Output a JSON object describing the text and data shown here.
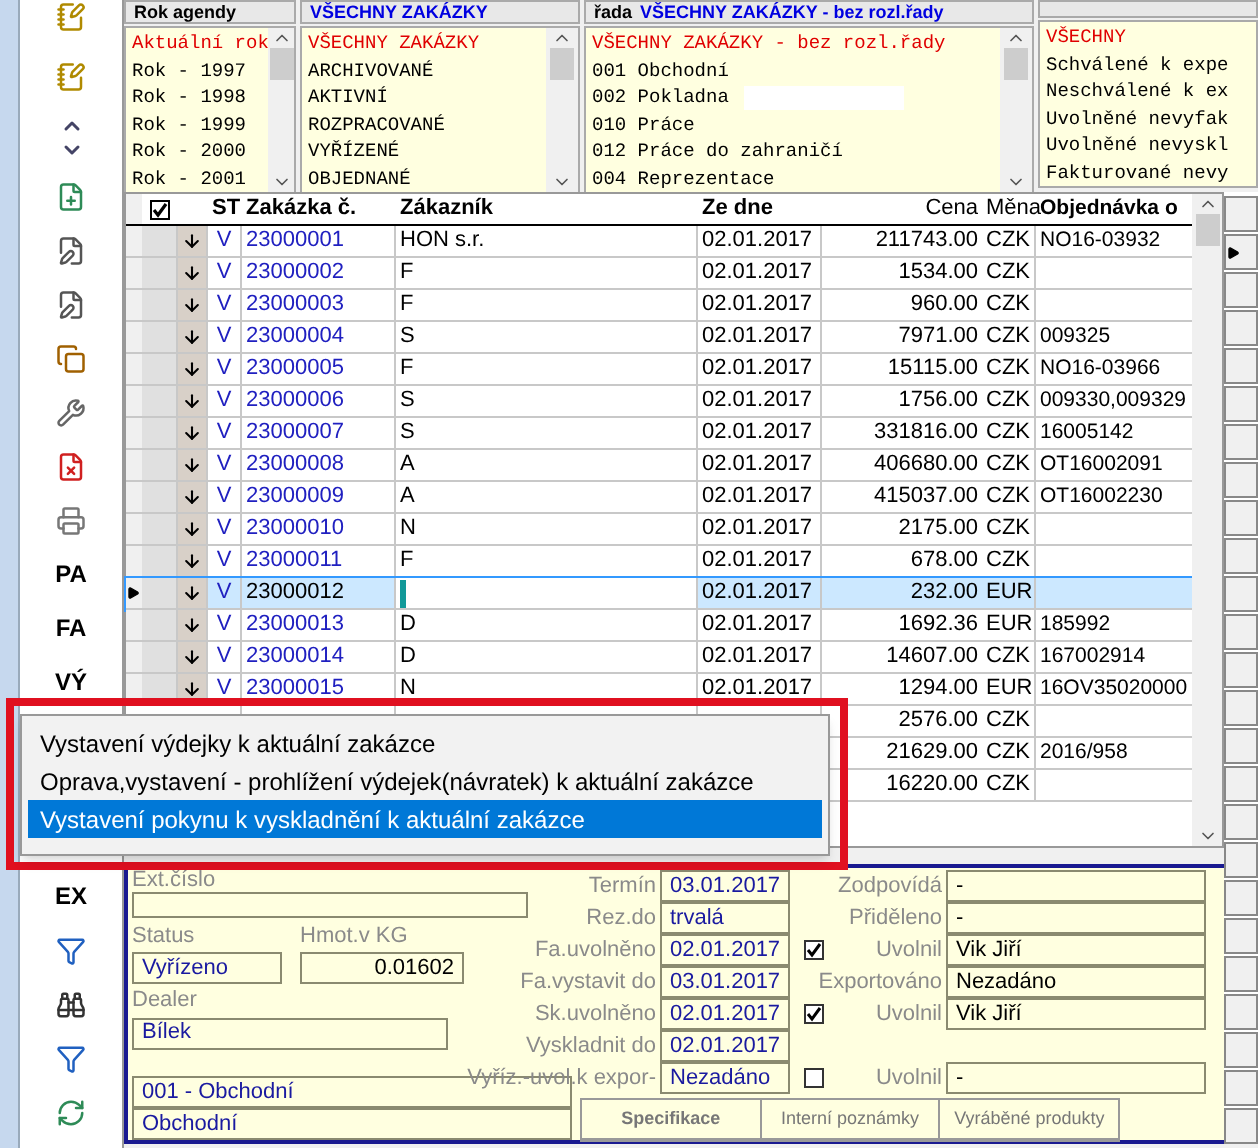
{
  "toolbar": [
    {
      "kind": "notes"
    },
    {
      "kind": "notes"
    },
    {
      "kind": "updown"
    },
    {
      "kind": "add"
    },
    {
      "kind": "edit"
    },
    {
      "kind": "edit"
    },
    {
      "kind": "copy"
    },
    {
      "kind": "tool"
    },
    {
      "kind": "delete"
    },
    {
      "kind": "print"
    },
    {
      "kind": "text",
      "label": "PA"
    },
    {
      "kind": "text",
      "label": "FA"
    },
    {
      "kind": "text",
      "label": "VÝ"
    },
    {
      "kind": "gap"
    },
    {
      "kind": "text",
      "label": "EX"
    },
    {
      "kind": "filter"
    },
    {
      "kind": "find"
    },
    {
      "kind": "filter"
    },
    {
      "kind": "refresh"
    }
  ],
  "lists": [
    {
      "header": "Rok agendy",
      "items": [
        {
          "text": "Aktuální rok",
          "selected": true
        },
        {
          "text": "Rok - 1997",
          "selected": false
        },
        {
          "text": "Rok - 1998",
          "selected": false
        },
        {
          "text": "Rok - 1999",
          "selected": false
        },
        {
          "text": "Rok - 2000",
          "selected": false
        },
        {
          "text": "Rok - 2001",
          "selected": false
        }
      ]
    },
    {
      "header": "VŠECHNY ZAKÁZKY",
      "items": [
        {
          "text": "VŠECHNY ZAKÁZKY",
          "selected": true
        },
        {
          "text": "ARCHIVOVANÉ",
          "selected": false
        },
        {
          "text": "AKTIVNÍ",
          "selected": false
        },
        {
          "text": "ROZPRACOVANÉ",
          "selected": false
        },
        {
          "text": "VYŘÍZENÉ",
          "selected": false
        },
        {
          "text": "OBJEDNANÉ",
          "selected": false
        }
      ]
    },
    {
      "header_prefix": "řada",
      "header": "VŠECHNY ZAKÁZKY - bez rozl.řady",
      "items": [
        {
          "text": "VŠECHNY ZAKÁZKY - bez rozl.řady",
          "selected": true
        },
        {
          "text": "001  Obchodní",
          "selected": false
        },
        {
          "text": "002  Pokladna",
          "selected": false,
          "redacted": true
        },
        {
          "text": "010  Práce",
          "selected": false
        },
        {
          "text": "012  Práce do zahraničí",
          "selected": false
        },
        {
          "text": "004  Reprezentace",
          "selected": false
        }
      ]
    },
    {
      "items": [
        {
          "text": "VŠECHNY",
          "selected": true
        },
        {
          "text": "Schválené k expe",
          "selected": false
        },
        {
          "text": "Neschválené k ex",
          "selected": false
        },
        {
          "text": "Uvolněné nevyfak",
          "selected": false
        },
        {
          "text": "Uvolněné nevyskl",
          "selected": false
        },
        {
          "text": "Fakturované nevy",
          "selected": false
        }
      ]
    }
  ],
  "table": {
    "columns": [
      "ST",
      "Zakázka č.",
      "Zákazník",
      "Ze dne",
      "Cena",
      "Měna",
      "Objednávka o"
    ],
    "rows": [
      {
        "st": "V",
        "id": "23000001",
        "customer": "HON s.r.",
        "date": "02.01.2017",
        "price": "211743.00",
        "currency": "CZK",
        "order": "NO16-03932",
        "selected": false
      },
      {
        "st": "V",
        "id": "23000002",
        "customer": "F",
        "date": "02.01.2017",
        "price": "1534.00",
        "currency": "CZK",
        "selected": false
      },
      {
        "st": "V",
        "id": "23000003",
        "customer": "F",
        "date": "02.01.2017",
        "price": "960.00",
        "currency": "CZK",
        "selected": false
      },
      {
        "st": "V",
        "id": "23000004",
        "customer": "S",
        "date": "02.01.2017",
        "price": "7971.00",
        "currency": "CZK",
        "order": "009325",
        "selected": false
      },
      {
        "st": "V",
        "id": "23000005",
        "customer": "F",
        "date": "02.01.2017",
        "price": "15115.00",
        "currency": "CZK",
        "order": "NO16-03966",
        "selected": false
      },
      {
        "st": "V",
        "id": "23000006",
        "customer": "S",
        "date": "02.01.2017",
        "price": "1756.00",
        "currency": "CZK",
        "order": "009330,009329",
        "selected": false
      },
      {
        "st": "V",
        "id": "23000007",
        "customer": "S",
        "date": "02.01.2017",
        "price": "331816.00",
        "currency": "CZK",
        "order": "16005142",
        "selected": false
      },
      {
        "st": "V",
        "id": "23000008",
        "customer": "A",
        "date": "02.01.2017",
        "price": "406680.00",
        "currency": "CZK",
        "order": "OT16002091",
        "selected": false
      },
      {
        "st": "V",
        "id": "23000009",
        "customer": "A",
        "date": "02.01.2017",
        "price": "415037.00",
        "currency": "CZK",
        "order": "OT16002230",
        "selected": false
      },
      {
        "st": "V",
        "id": "23000010",
        "customer": "N",
        "date": "02.01.2017",
        "price": "2175.00",
        "currency": "CZK",
        "selected": false
      },
      {
        "st": "V",
        "id": "23000011",
        "customer": "F",
        "date": "02.01.2017",
        "price": "678.00",
        "currency": "CZK",
        "selected": false
      },
      {
        "st": "V",
        "id": "23000012",
        "date": "02.01.2017",
        "price": "232.00",
        "currency": "EUR",
        "selected": true
      },
      {
        "st": "V",
        "id": "23000013",
        "customer": "D",
        "date": "02.01.2017",
        "price": "1692.36",
        "currency": "EUR",
        "order": "185992",
        "selected": false
      },
      {
        "st": "V",
        "id": "23000014",
        "customer": "D",
        "date": "02.01.2017",
        "price": "14607.00",
        "currency": "CZK",
        "order": "167002914",
        "selected": false
      },
      {
        "st": "V",
        "id": "23000015",
        "customer": "N",
        "date": "02.01.2017",
        "price": "1294.00",
        "currency": "EUR",
        "order": "16OV35020000",
        "selected": false
      },
      {
        "price": "2576.00",
        "currency": "CZK",
        "selected": false
      },
      {
        "price": "21629.00",
        "currency": "CZK",
        "order": "2016/958",
        "selected": false
      },
      {
        "price": "16220.00",
        "currency": "CZK",
        "selected": false
      }
    ]
  },
  "context_menu": {
    "items": [
      {
        "text": "Vystavení výdejky k aktuální zakázce",
        "selected": false
      },
      {
        "text": "Oprava,vystavení - prohlížení výdejek(návratek) k aktuální zakázce",
        "selected": false
      },
      {
        "text": "Vystavení pokynu k vyskladnění k aktuální zakázce",
        "selected": true
      }
    ]
  },
  "form": {
    "ext_label": "Ext.číslo",
    "status_label": "Status",
    "status": "Vyřízeno",
    "weight_label": "Hmot.v KG",
    "weight": "0.01602",
    "dealer_label": "Dealer",
    "dealer": "Bílek",
    "series": "001 - Obchodní",
    "series_name": "Obchodní",
    "rows": [
      {
        "label": "Termín",
        "value": "03.01.2017",
        "label2": "Zodpovídá",
        "value2": "-"
      },
      {
        "label": "Rez.do",
        "value": "trvalá",
        "label2": "Přiděleno",
        "value2": "-"
      },
      {
        "label": "Fa.uvolněno",
        "value": "02.01.2017",
        "checked": true,
        "label2": "Uvolnil",
        "value2": "Vik Jiří"
      },
      {
        "label": "Fa.vystavit do",
        "value": "03.01.2017",
        "label2": "Exportováno",
        "value2": "Nezadáno"
      },
      {
        "label": "Sk.uvolněno",
        "value": "02.01.2017",
        "checked": true,
        "label2": "Uvolnil",
        "value2": "Vik Jiří"
      },
      {
        "label": "Vyskladnit do",
        "value": "02.01.2017"
      },
      {
        "label": "Vyříz.-uvol.k expor-",
        "value": "Nezadáno",
        "checked": false,
        "label2": "Uvolnil",
        "value2": "-"
      }
    ],
    "tabs": [
      "Specifikace",
      "Interní poznámky",
      "Vyráběné produkty"
    ]
  }
}
